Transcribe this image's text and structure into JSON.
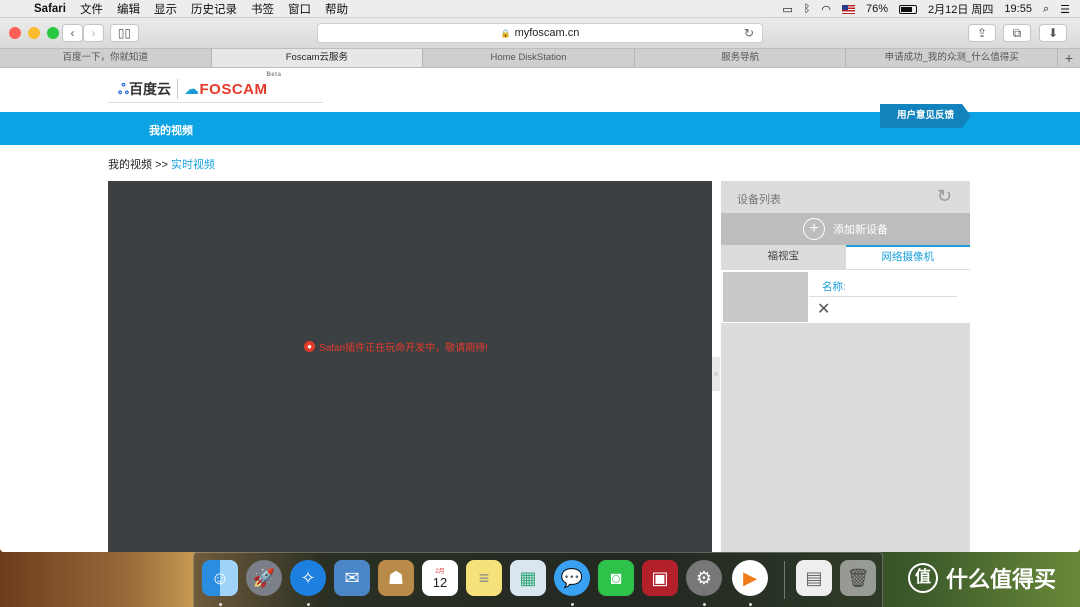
{
  "menubar": {
    "app_name": "Safari",
    "menus": [
      "文件",
      "编辑",
      "显示",
      "历史记录",
      "书签",
      "窗口",
      "帮助"
    ],
    "battery": "76%",
    "date": "2月12日 周四",
    "time": "19:55"
  },
  "browser": {
    "url": "myfoscam.cn",
    "tabs": [
      "百度一下，你就知道",
      "Foscam云服务",
      "Home DiskStation",
      "服务导航",
      "申请成功_我的众测_什么值得买"
    ],
    "active_tab": 1
  },
  "page": {
    "logo_baidu": "百度云",
    "logo_foscam": "FOSCAM",
    "logo_beta": "Beta",
    "nav_my_videos": "我的视频",
    "feedback": "用户意见反馈",
    "breadcrumb_root": "我的视频",
    "breadcrumb_sep": ">>",
    "breadcrumb_current": "实时视频",
    "video_message": "Safari插件正在玩命开发中，敬请期待!",
    "panel": {
      "title": "设备列表",
      "add_device": "添加新设备",
      "tabs": [
        "福视宝",
        "网络摄像机"
      ],
      "active_tab": 1,
      "device_name_label": "名称:"
    }
  },
  "dock": {
    "apps": [
      "finder-icon",
      "launchpad-icon",
      "safari-icon",
      "mail-icon",
      "contacts-icon",
      "calendar-icon",
      "notes-icon",
      "preview-icon",
      "messages-icon",
      "facetime-icon",
      "photo-booth-icon",
      "system-preferences-icon",
      "music-player-icon",
      "documents-icon",
      "trash-icon"
    ],
    "calendar_month": "2月",
    "calendar_day": "12"
  },
  "watermark": "什么值得买",
  "colors": {
    "accent": "#0ba3e3",
    "feedback": "#1283bd",
    "error": "#e03a2a",
    "video_bg": "#3d4043"
  }
}
